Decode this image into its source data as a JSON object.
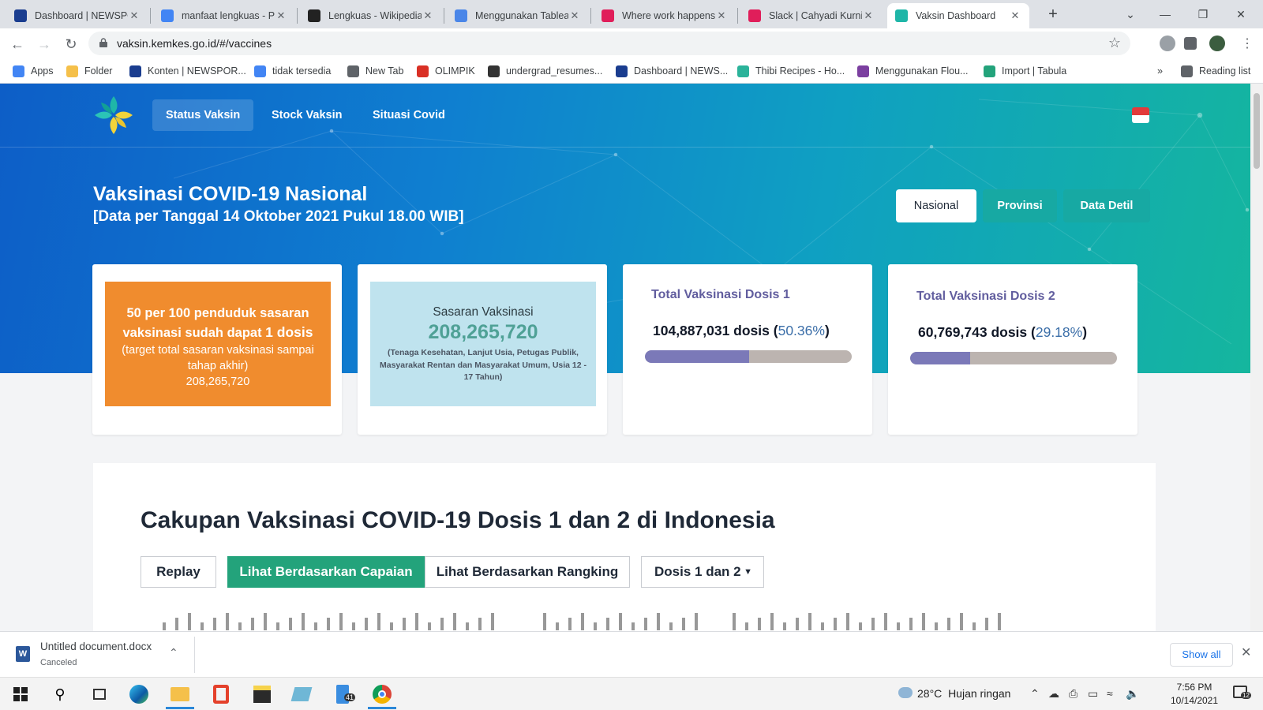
{
  "browser": {
    "tabs": [
      {
        "title": "Dashboard | NEWSPOR",
        "icon": "d-logo-icon",
        "color": "#1a3d8f"
      },
      {
        "title": "manfaat lengkuas - Pe",
        "icon": "google-icon",
        "color": "#4285f4"
      },
      {
        "title": "Lengkuas - Wikipedia",
        "icon": "wikipedia-icon",
        "color": "#222222"
      },
      {
        "title": "Menggunakan Tablea",
        "icon": "docs-icon",
        "color": "#4a86e8"
      },
      {
        "title": "Where work happens",
        "icon": "slack-icon",
        "color": "#e01e5a"
      },
      {
        "title": "Slack | Cahyadi Kurnia",
        "icon": "slack-icon",
        "color": "#e01e5a"
      },
      {
        "title": "Vaksin Dashboard",
        "icon": "kemkes-icon",
        "color": "#1fb6a8"
      }
    ],
    "active_tab": 6,
    "new_tab_label": "+",
    "url": "vaksin.kemkes.go.id/#/vaccines",
    "bookmarks": [
      {
        "label": "Apps",
        "icon": "apps-grid-icon",
        "color": "#4285f4"
      },
      {
        "label": "Folder",
        "icon": "folder-icon",
        "color": "#f5c04a"
      },
      {
        "label": "Konten | NEWSPOR...",
        "icon": "d-logo-icon",
        "color": "#1a3d8f"
      },
      {
        "label": "tidak tersedia",
        "icon": "google-icon",
        "color": "#4285f4"
      },
      {
        "label": "New Tab",
        "icon": "globe-icon",
        "color": "#5f6368"
      },
      {
        "label": "OLIMPIK",
        "icon": "olimpik-icon",
        "color": "#d93025"
      },
      {
        "label": "undergrad_resumes...",
        "icon": "github-icon",
        "color": "#333333"
      },
      {
        "label": "Dashboard | NEWS...",
        "icon": "d-logo-icon",
        "color": "#1a3d8f"
      },
      {
        "label": "Thibi Recipes - Ho...",
        "icon": "thibi-icon",
        "color": "#2bb39a"
      },
      {
        "label": "Menggunakan Flou...",
        "icon": "flourish-icon",
        "color": "#7b3fa0"
      },
      {
        "label": "Import | Tabula",
        "icon": "tabula-icon",
        "color": "#23a37b"
      }
    ],
    "more_bookmarks": "»",
    "reading_list": "Reading list"
  },
  "site": {
    "nav": [
      "Status Vaksin",
      "Stock Vaksin",
      "Situasi Covid"
    ],
    "active_nav": 0,
    "hero_title": "Vaksinasi COVID-19 Nasional",
    "hero_subtitle": "[Data per Tanggal 14 Oktober 2021 Pukul 18.00 WIB]",
    "scope_buttons": [
      "Nasional",
      "Provinsi",
      "Data Detil"
    ],
    "active_scope": 0,
    "card1": {
      "line_a": "50 per 100 penduduk sasaran vaksinasi sudah dapat",
      "line_a_bold": "1 dosis",
      "line_b": "(target total sasaran vaksinasi sampai tahap akhir)",
      "line_c": "208,265,720"
    },
    "card2": {
      "label": "Sasaran Vaksinasi",
      "value": "208,265,720",
      "note": "(Tenaga Kesehatan, Lanjut Usia, Petugas Publik, Masyarakat Rentan dan Masyarakat Umum, Usia 12 - 17 Tahun)"
    },
    "dose1": {
      "title": "Total Vaksinasi Dosis 1",
      "count": "104,887,031 dosis",
      "open_paren": "(",
      "percent": "50.36%",
      "close_paren": ")",
      "progress": 0.5036
    },
    "dose2": {
      "title": "Total Vaksinasi Dosis 2",
      "count": "60,769,743 dosis",
      "open_paren": "(",
      "percent": "29.18%",
      "close_paren": ")",
      "progress": 0.2918
    },
    "panel_title": "Cakupan Vaksinasi COVID-19 Dosis 1 dan 2 di Indonesia",
    "panel_buttons": {
      "replay": "Replay",
      "capaian": "Lihat Berdasarkan Capaian",
      "rangking": "Lihat Berdasarkan Rangking",
      "dosis_select": "Dosis 1 dan 2"
    }
  },
  "download": {
    "filename": "Untitled document.docx",
    "status": "Canceled",
    "show_all": "Show all"
  },
  "taskbar": {
    "weather_temp": "28°C",
    "weather_desc": "Hujan ringan",
    "time": "7:56 PM",
    "date": "10/14/2021",
    "notif_count": "12",
    "badge_count": "41"
  },
  "colors": {
    "hero_start": "#0d5ec7",
    "hero_end": "#15b69e",
    "orange": "#f08c2e",
    "teal_value": "#4fa196",
    "dose_title": "#615d9e",
    "progress_fill": "#7b79b8",
    "green_button": "#23a37b"
  }
}
